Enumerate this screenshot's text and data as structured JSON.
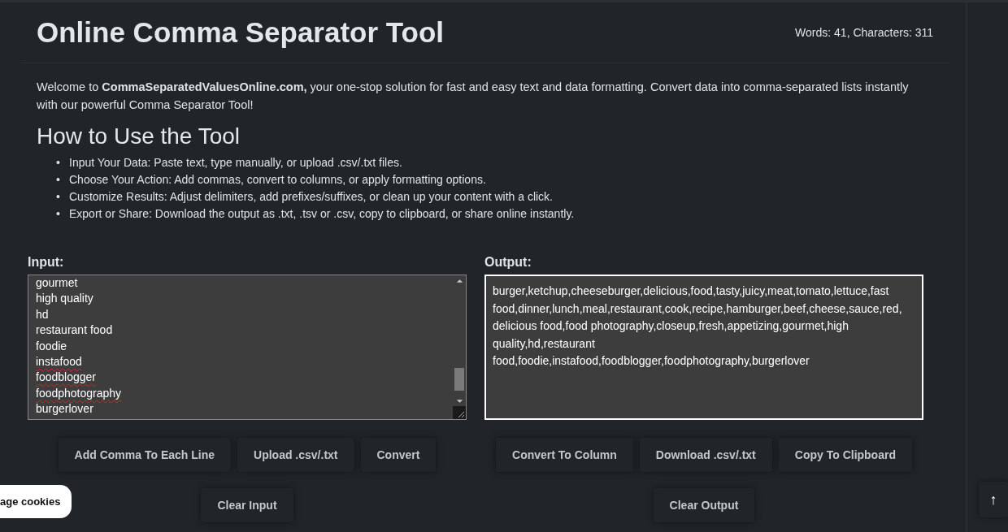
{
  "header": {
    "title": "Online Comma Separator Tool",
    "stats": "Words: 41, Characters: 311"
  },
  "intro": "Welcome to **CommaSeparatedValuesOnline.com,** your one-stop solution for fast and easy text and data formatting. Convert data into comma-separated lists instantly with our powerful Comma Separator Tool!",
  "howto": {
    "heading": "How to Use the Tool",
    "steps": [
      {
        "marker": "•",
        "text": "Input Your Data: Paste text, type manually, or upload .csv/.txt files."
      },
      {
        "marker": "•",
        "text": "Choose Your Action: Add commas, convert to columns, or apply formatting options."
      },
      {
        "marker": "•",
        "text": "Customize Results: Adjust delimiters, add prefixes/suffixes, or clean up your content with a click."
      },
      {
        "marker": "•",
        "text": "Export or Share: Download the output as .txt, .tsv or .csv, copy to clipboard, or share online instantly."
      }
    ]
  },
  "input": {
    "label": "Input:",
    "lines": [
      {
        "text": "gourmet",
        "misspelled": false
      },
      {
        "text": "high quality",
        "misspelled": false
      },
      {
        "text": "hd",
        "misspelled": false
      },
      {
        "text": "restaurant food",
        "misspelled": false
      },
      {
        "text": "foodie",
        "misspelled": false
      },
      {
        "text": "instafood",
        "misspelled": true
      },
      {
        "text": "foodblogger",
        "misspelled": true
      },
      {
        "text": "foodphotography",
        "misspelled": true
      },
      {
        "text": "burgerlover",
        "misspelled": false
      }
    ],
    "buttons": [
      "Add Comma To Each Line",
      "Upload .csv/.txt",
      "Convert"
    ],
    "clear": "Clear Input"
  },
  "output": {
    "label": "Output:",
    "value": "burger,ketchup,cheeseburger,delicious,food,tasty,juicy,meat,tomato,lettuce,fast food,dinner,lunch,meal,restaurant,cook,recipe,hamburger,beef,cheese,sauce,red, delicious food,food photography,closeup,fresh,appetizing,gourmet,high quality,hd,restaurant food,foodie,instafood,foodblogger,foodphotography,burgerlover",
    "focused": true,
    "buttons": [
      "Convert To Column",
      "Download .csv/.txt",
      "Copy To Clipboard"
    ],
    "clear": "Clear Output"
  },
  "cookies": "age cookies",
  "scroll_top": "↑"
}
